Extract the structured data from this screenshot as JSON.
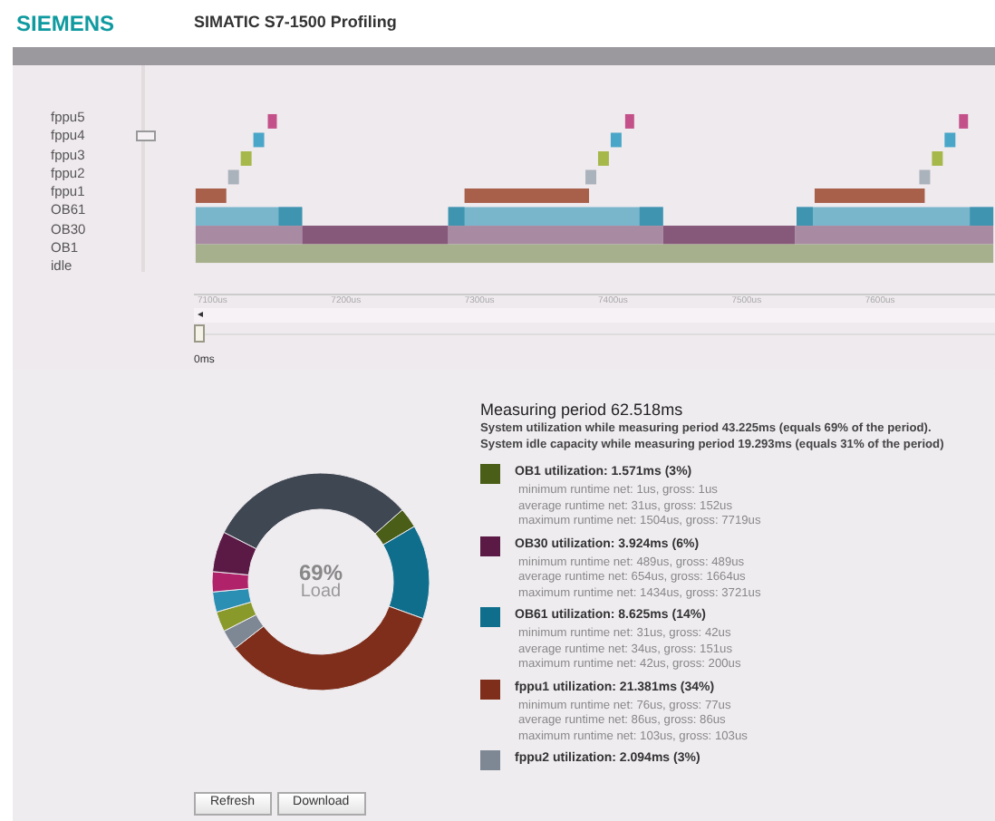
{
  "header": {
    "logo": "SIEMENS",
    "title": "SIMATIC S7-1500 Profiling"
  },
  "timeline": {
    "rows": [
      "fppu5",
      "fppu4",
      "fppu3",
      "fppu2",
      "fppu1",
      "OB61",
      "OB30",
      "OB1",
      "idle"
    ],
    "ticks": [
      "7100us",
      "7200us",
      "7300us",
      "7400us",
      "7500us",
      "7600us"
    ],
    "scroll_arrow": "◂",
    "slider_label": "0ms"
  },
  "summary": {
    "title": "Measuring period 62.518ms",
    "lines": [
      "System utilization while measuring period 43.225ms (equals 69% of the period).",
      "System idle capacity while measuring period 19.293ms (equals 31% of the period)"
    ],
    "items": [
      {
        "title": "OB1 utilization: 1.571ms (3%)",
        "color": "#4a5e17",
        "details": [
          "minimum runtime net: 1us, gross: 1us",
          "average runtime net: 31us, gross: 152us",
          "maximum runtime net: 1504us, gross: 7719us"
        ]
      },
      {
        "title": "OB30 utilization: 3.924ms (6%)",
        "color": "#5a1a45",
        "details": [
          "minimum runtime net: 489us, gross: 489us",
          "average runtime net: 654us, gross: 1664us",
          "maximum runtime net: 1434us, gross: 3721us"
        ]
      },
      {
        "title": "OB61 utilization: 8.625ms (14%)",
        "color": "#0e6e8c",
        "details": [
          "minimum runtime net: 31us, gross: 42us",
          "average runtime net: 34us, gross: 151us",
          "maximum runtime net: 42us, gross: 200us"
        ]
      },
      {
        "title": "fppu1 utilization: 21.381ms (34%)",
        "color": "#7e2e1a",
        "details": [
          "minimum runtime net: 76us, gross: 77us",
          "average runtime net: 86us, gross: 86us",
          "maximum runtime net: 103us, gross: 103us"
        ]
      },
      {
        "title": "fppu2 utilization: 2.094ms (3%)",
        "color": "#7d8894"
      }
    ]
  },
  "load": {
    "value": "69%",
    "label": "Load"
  },
  "buttons": [
    "Refresh",
    "Download"
  ]
}
